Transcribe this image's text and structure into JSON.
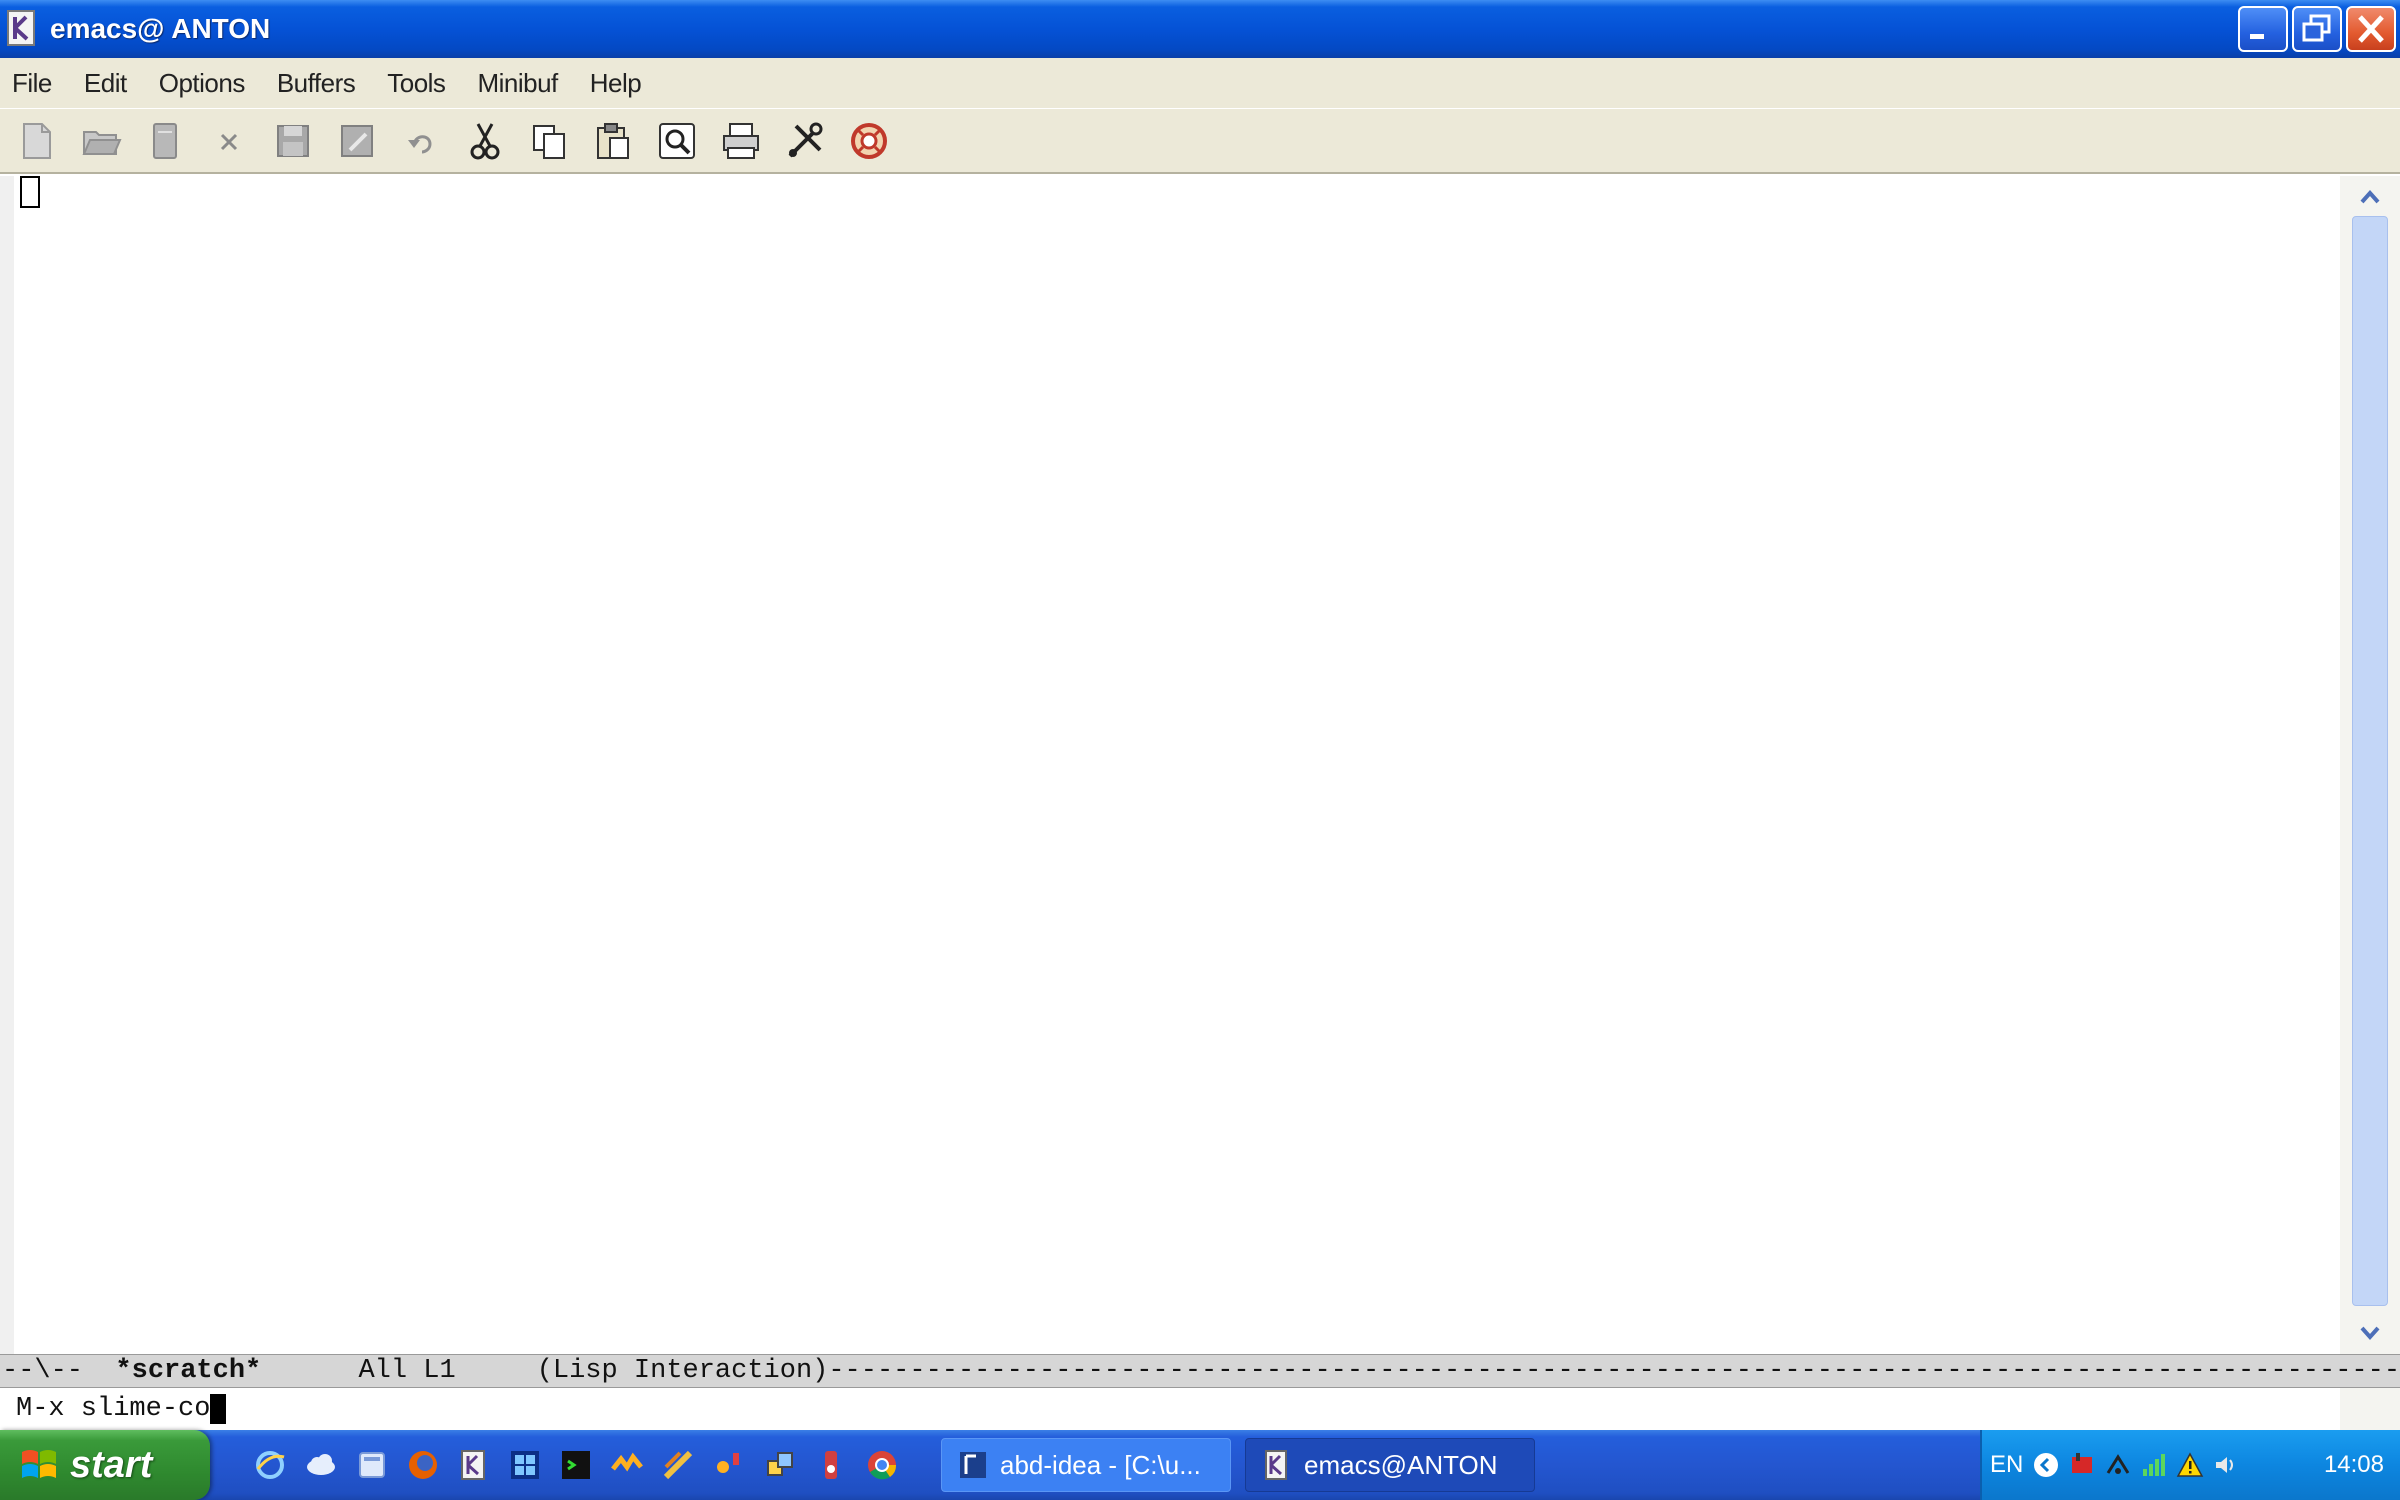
{
  "window": {
    "title": "emacs@ ANTON"
  },
  "menu": {
    "items": [
      "File",
      "Edit",
      "Options",
      "Buffers",
      "Tools",
      "Minibuf",
      "Help"
    ]
  },
  "toolbar": {
    "icons": [
      "new-file-icon",
      "open-folder-icon",
      "dired-icon",
      "close-buffer-icon",
      "save-icon",
      "save-as-icon",
      "undo-icon",
      "cut-icon",
      "copy-icon",
      "paste-icon",
      "search-icon",
      "print-icon",
      "preferences-icon",
      "help-icon"
    ]
  },
  "modeline": {
    "prefix": "--\\--  ",
    "buffer": "*scratch*",
    "position": "      All L1     ",
    "mode": "(Lisp Interaction)",
    "dashes": "------------------------------------------------------------------------------------------------------"
  },
  "minibuffer": {
    "text": "M-x slime-co"
  },
  "taskbar": {
    "start_label": "start",
    "quick_launch": [
      "ie-icon",
      "cloud-icon",
      "folder-icon",
      "firefox-icon",
      "emacs-icon",
      "windows-icon",
      "terminal-icon",
      "tool-icon",
      "app-icon",
      "app2-icon",
      "network-icon",
      "media-icon",
      "chrome-icon"
    ],
    "tasks": [
      {
        "label": "abd-idea - [C:\\u...",
        "icon": "idea-icon"
      },
      {
        "label": "emacs@ANTON",
        "icon": "emacs-icon"
      }
    ],
    "tray": {
      "language": "EN",
      "clock": "14:08"
    }
  },
  "colors": {
    "titlebar": "#0552d6",
    "menubar": "#ece9d8",
    "modeline": "#d6d6d6",
    "taskbar": "#2456d0",
    "start": "#3a9a3a"
  }
}
